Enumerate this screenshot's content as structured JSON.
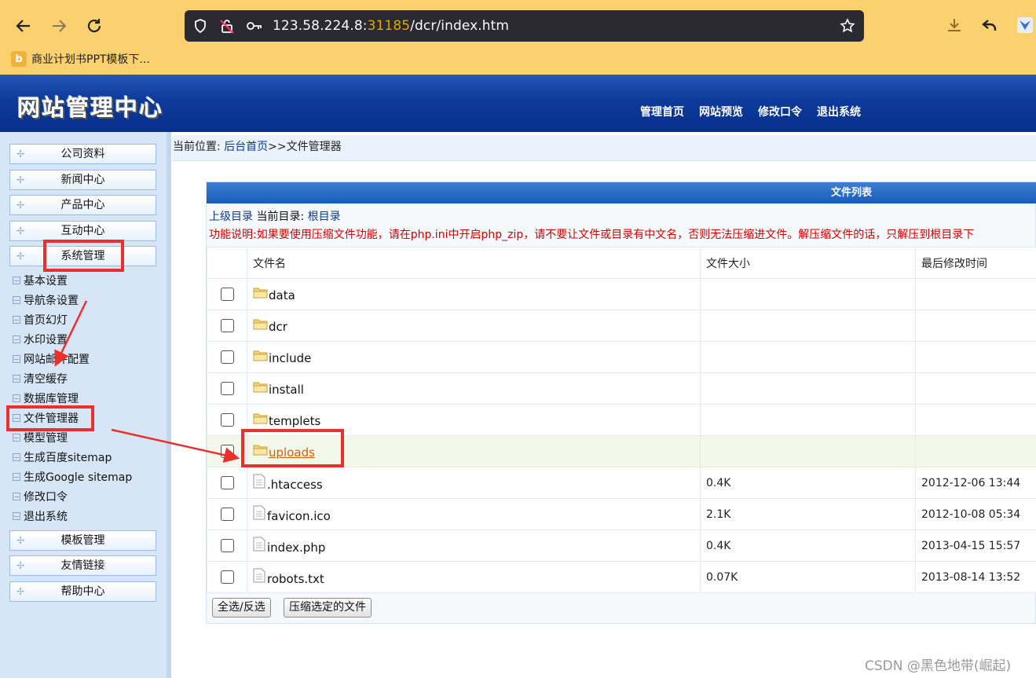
{
  "browser": {
    "url_host": "123.58.224.8:",
    "url_port": "31185",
    "url_path": "/dcr/index.htm",
    "bookmark_label": "商业计划书PPT模板下...",
    "bookmark_icon_letter": "b"
  },
  "site": {
    "logo": "网站管理中心",
    "top_nav": [
      "管理首页",
      "网站预览",
      "修改口令",
      "退出系统"
    ]
  },
  "sidebar": {
    "sections": [
      "公司资料",
      "新闻中心",
      "产品中心",
      "互动中心",
      "系统管理",
      "模板管理",
      "友情链接",
      "帮助中心"
    ],
    "system_items": [
      "基本设置",
      "导航条设置",
      "首页幻灯",
      "水印设置",
      "网站邮件配置",
      "清空缓存",
      "数据库管理",
      "文件管理器",
      "模型管理",
      "生成百度sitemap",
      "生成Google sitemap",
      "修改口令",
      "退出系统"
    ]
  },
  "breadcrumb": {
    "prefix": "当前位置: ",
    "home": "后台首页",
    "sep": ">>",
    "current": "文件管理器"
  },
  "panel": {
    "title": "文件列表",
    "parent_dir": "上级目录",
    "current_dir_label": " 当前目录: ",
    "current_dir": "根目录",
    "note": "功能说明:如果要使用压缩文件功能，请在php.ini中开启php_zip，请不要让文件或目录有中文名，否则无法压缩进文件。解压缩文件的话，只解压到根目录下",
    "columns": [
      "文件名",
      "文件大小",
      "最后修改时间"
    ],
    "files": [
      {
        "name": "data",
        "type": "folder",
        "size": "",
        "mtime": ""
      },
      {
        "name": "dcr",
        "type": "folder",
        "size": "",
        "mtime": ""
      },
      {
        "name": "include",
        "type": "folder",
        "size": "",
        "mtime": ""
      },
      {
        "name": "install",
        "type": "folder",
        "size": "",
        "mtime": ""
      },
      {
        "name": "templets",
        "type": "folder",
        "size": "",
        "mtime": ""
      },
      {
        "name": "uploads",
        "type": "folder",
        "size": "",
        "mtime": "",
        "highlighted": true
      },
      {
        "name": ".htaccess",
        "type": "file",
        "size": "0.4K",
        "mtime": "2012-12-06 13:44"
      },
      {
        "name": "favicon.ico",
        "type": "file",
        "size": "2.1K",
        "mtime": "2012-10-08 05:34"
      },
      {
        "name": "index.php",
        "type": "file",
        "size": "0.4K",
        "mtime": "2013-04-15 15:57"
      },
      {
        "name": "robots.txt",
        "type": "file",
        "size": "0.07K",
        "mtime": "2013-08-14 13:52"
      }
    ],
    "select_all_button": "全选/反选",
    "compress_button": "压缩选定的文件"
  },
  "watermark": "CSDN @黑色地带(崛起)",
  "colors": {
    "browser_bg": "#fbd06e",
    "header_blue": "#0d3a9b",
    "annotation_red": "#e8312c",
    "note_red": "#d40000"
  }
}
